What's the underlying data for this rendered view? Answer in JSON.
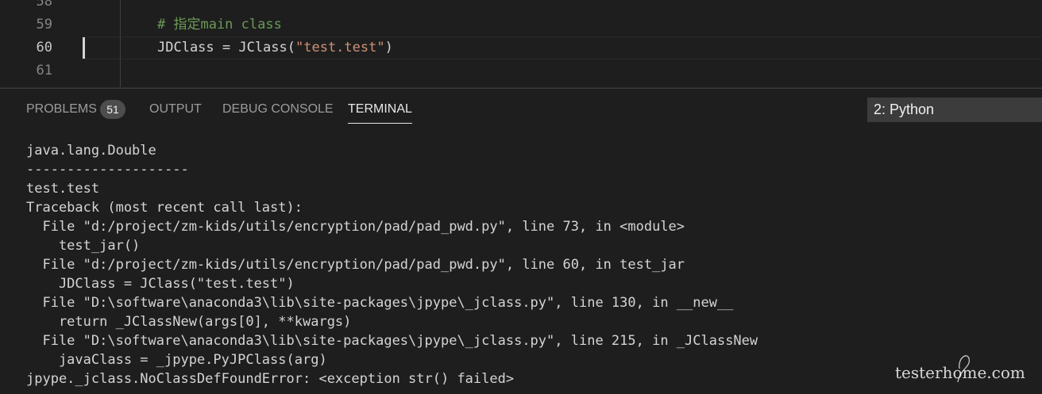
{
  "editor": {
    "lines": [
      {
        "number": "58",
        "code": "",
        "type": "blank"
      },
      {
        "number": "59",
        "code": "# 指定main class",
        "type": "comment"
      },
      {
        "number": "60",
        "code_prefix": "JDClass = JClass(",
        "code_string": "\"test.test\"",
        "code_suffix": ")",
        "type": "code"
      },
      {
        "number": "61",
        "code": "",
        "type": "blank"
      }
    ]
  },
  "panel": {
    "tabs": [
      {
        "label": "PROBLEMS"
      },
      {
        "label": "OUTPUT"
      },
      {
        "label": "DEBUG CONSOLE"
      },
      {
        "label": "TERMINAL"
      }
    ],
    "problems_count": "51",
    "terminal_selector": "2: Python"
  },
  "terminal": {
    "lines": [
      "java.lang.Double",
      "--------------------",
      "test.test",
      "Traceback (most recent call last):",
      "  File \"d:/project/zm-kids/utils/encryption/pad/pad_pwd.py\", line 73, in <module>",
      "    test_jar()",
      "  File \"d:/project/zm-kids/utils/encryption/pad/pad_pwd.py\", line 60, in test_jar",
      "    JDClass = JClass(\"test.test\")",
      "  File \"D:\\software\\anaconda3\\lib\\site-packages\\jpype\\_jclass.py\", line 130, in __new__",
      "    return _JClassNew(args[0], **kwargs)",
      "  File \"D:\\software\\anaconda3\\lib\\site-packages\\jpype\\_jclass.py\", line 215, in _JClassNew",
      "    javaClass = _jpype.PyJPClass(arg)",
      "jpype._jclass.NoClassDefFoundError: <exception str() failed>"
    ]
  },
  "watermark": {
    "text": "testerhome.com"
  },
  "colors": {
    "background": "#1e1e1e",
    "comment": "#6a9955",
    "string": "#ce9178",
    "text": "#d4d4d4",
    "badge": "#4d4d4d"
  }
}
